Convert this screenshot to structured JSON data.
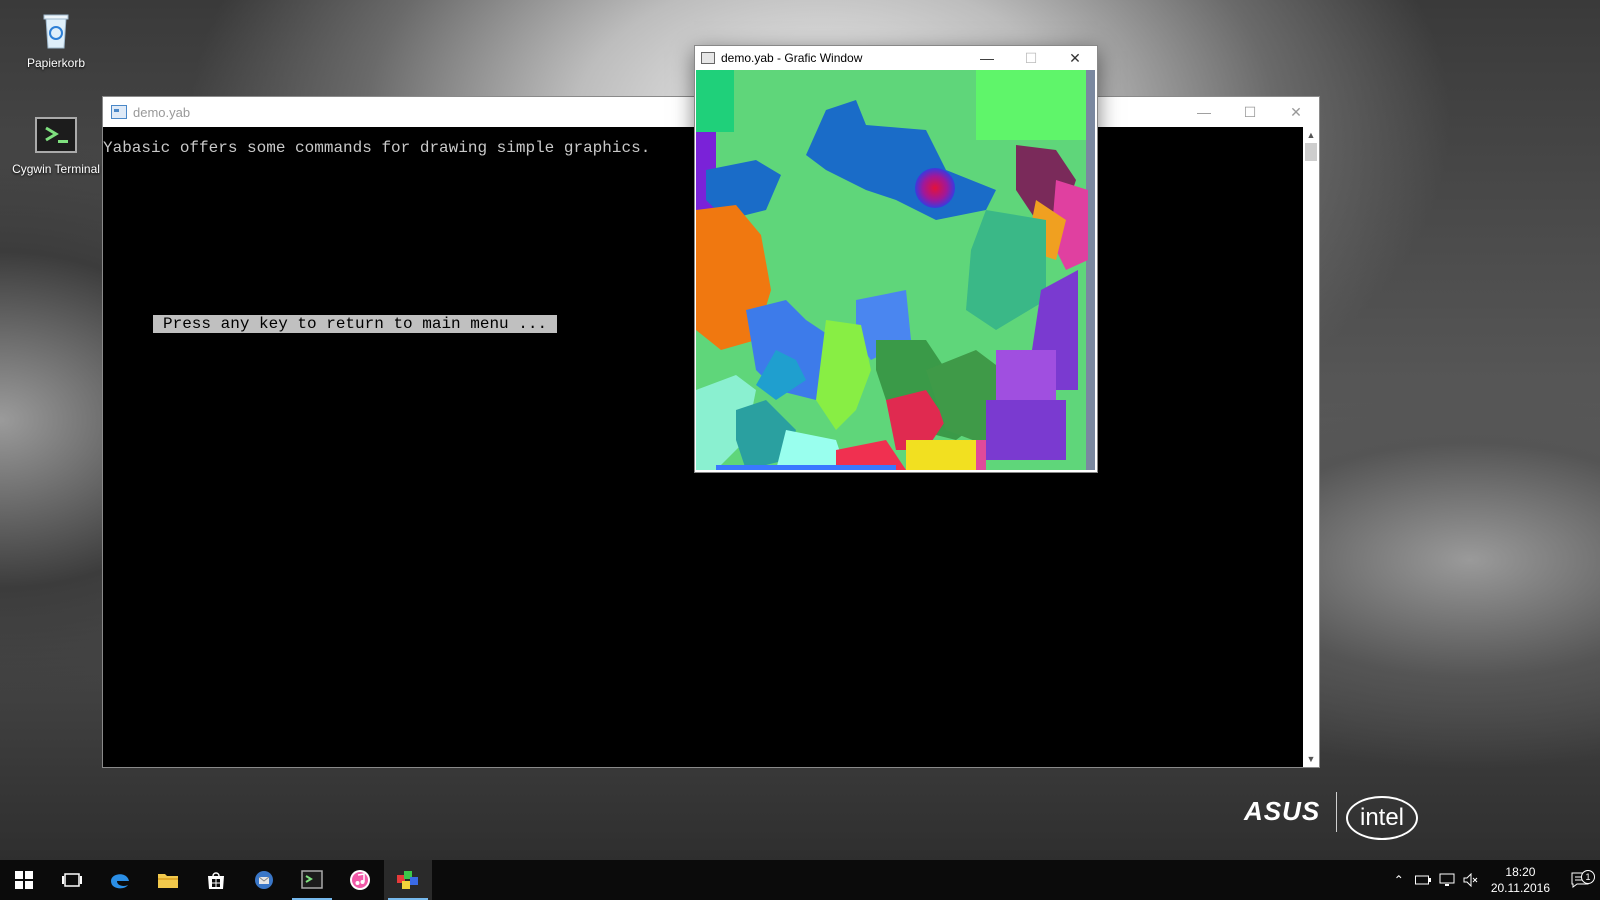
{
  "desktop": {
    "icons": [
      {
        "label": "Papierkorb"
      },
      {
        "label": "Cygwin Terminal"
      }
    ],
    "brands": {
      "asus": "ASUS",
      "intel": "intel"
    }
  },
  "console_window": {
    "title": "demo.yab",
    "lines": [
      "Yabasic offers some commands for drawing simple graphics."
    ],
    "prompt": "Press any key to return to main menu ..."
  },
  "grafic_window": {
    "title": "demo.yab - Grafic Window"
  },
  "taskbar": {
    "apps": [
      "start",
      "task-view",
      "edge",
      "file-explorer",
      "store",
      "thunderbird",
      "cygwin-terminal",
      "itunes",
      "yabasic"
    ],
    "clock": {
      "time": "18:20",
      "date": "20.11.2016"
    },
    "notification_count": "1"
  },
  "colors": {
    "accent": "#76b9ed",
    "console_bg": "#000000",
    "prompt_bg": "#c0c0c0"
  }
}
